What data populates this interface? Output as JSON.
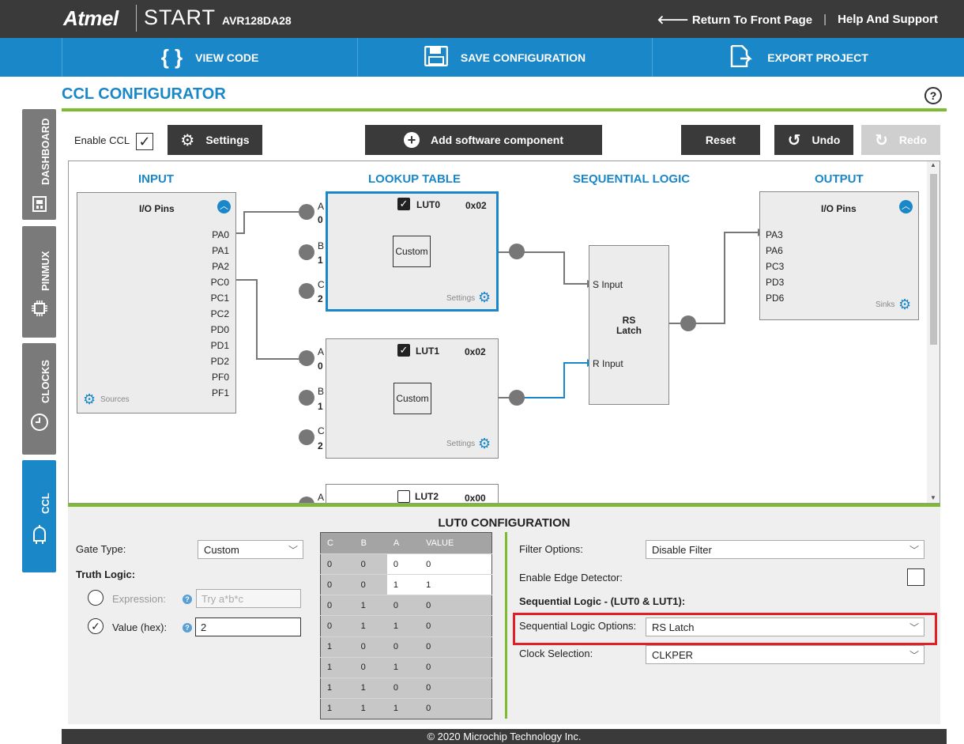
{
  "app": {
    "brand": "Atmel",
    "product": "START",
    "device": "AVR128DA28"
  },
  "top_links": {
    "return": "Return To Front Page",
    "help": "Help And Support"
  },
  "toolbar": {
    "view_code": "VIEW CODE",
    "save": "SAVE CONFIGURATION",
    "export": "EXPORT PROJECT"
  },
  "sidebar": {
    "items": [
      {
        "label": "DASHBOARD",
        "icon": "dashboard-icon"
      },
      {
        "label": "PINMUX",
        "icon": "chip-icon"
      },
      {
        "label": "CLOCKS",
        "icon": "clock-icon"
      },
      {
        "label": "CCL",
        "icon": "logic-gate-icon"
      }
    ],
    "active": "CCL"
  },
  "page": {
    "title": "CCL CONFIGURATOR",
    "help": "?"
  },
  "controls": {
    "enable_ccl": "Enable CCL",
    "enable_checked": true,
    "settings": "Settings",
    "add_component": "Add software component",
    "reset": "Reset",
    "undo": "Undo",
    "redo": "Redo"
  },
  "diagram": {
    "columns": {
      "input": "INPUT",
      "lut": "LOOKUP TABLE",
      "seq": "SEQUENTIAL LOGIC",
      "output": "OUTPUT"
    },
    "input_box": {
      "title": "I/O Pins",
      "pins": [
        "PA0",
        "PA1",
        "PA2",
        "PC0",
        "PC1",
        "PC2",
        "PD0",
        "PD1",
        "PD2",
        "PF0",
        "PF1"
      ],
      "footer": "Sources"
    },
    "luts": [
      {
        "name": "LUT0",
        "value": "0x02",
        "checked": true,
        "gate": "Custom",
        "settings": "Settings",
        "inputs": [
          {
            "letter": "A",
            "idx": "0"
          },
          {
            "letter": "B",
            "idx": "1"
          },
          {
            "letter": "C",
            "idx": "2"
          }
        ]
      },
      {
        "name": "LUT1",
        "value": "0x02",
        "checked": true,
        "gate": "Custom",
        "settings": "Settings",
        "inputs": [
          {
            "letter": "A",
            "idx": "0"
          },
          {
            "letter": "B",
            "idx": "1"
          },
          {
            "letter": "C",
            "idx": "2"
          }
        ]
      },
      {
        "name": "LUT2",
        "value": "0x00",
        "checked": false,
        "inputs": [
          {
            "letter": "A",
            "idx": ""
          }
        ]
      }
    ],
    "seq": {
      "s_input": "S Input",
      "r_input": "R Input",
      "title_line1": "RS",
      "title_line2": "Latch"
    },
    "output_box": {
      "title": "I/O Pins",
      "pins": [
        "PA3",
        "PA6",
        "PC3",
        "PD3",
        "PD6"
      ],
      "footer": "Sinks"
    }
  },
  "config": {
    "title": "LUT0 CONFIGURATION",
    "gate_type_label": "Gate Type:",
    "gate_type_value": "Custom",
    "truth_logic": "Truth Logic:",
    "expression_label": "Expression:",
    "expression_placeholder": "Try a*b*c",
    "value_label": "Value (hex):",
    "value_hex": "2",
    "truth_table": {
      "headers": [
        "C",
        "B",
        "A",
        "VALUE"
      ],
      "rows": [
        [
          "0",
          "0",
          "0",
          "0"
        ],
        [
          "0",
          "0",
          "1",
          "1"
        ],
        [
          "0",
          "1",
          "0",
          "0"
        ],
        [
          "0",
          "1",
          "1",
          "0"
        ],
        [
          "1",
          "0",
          "0",
          "0"
        ],
        [
          "1",
          "0",
          "1",
          "0"
        ],
        [
          "1",
          "1",
          "0",
          "0"
        ],
        [
          "1",
          "1",
          "1",
          "0"
        ]
      ]
    },
    "filter_label": "Filter Options:",
    "filter_value": "Disable Filter",
    "edge_label": "Enable Edge Detector:",
    "seq_heading": "Sequential Logic - (LUT0 & LUT1):",
    "seq_label": "Sequential Logic Options:",
    "seq_value": "RS Latch",
    "clock_label": "Clock Selection:",
    "clock_value": "CLKPER"
  },
  "footer": "© 2020 Microchip Technology Inc.",
  "colors": {
    "accent": "#1a87c9",
    "green": "#7dbb2f",
    "dark": "#3a3a3a",
    "highlight": "#e01f26"
  }
}
